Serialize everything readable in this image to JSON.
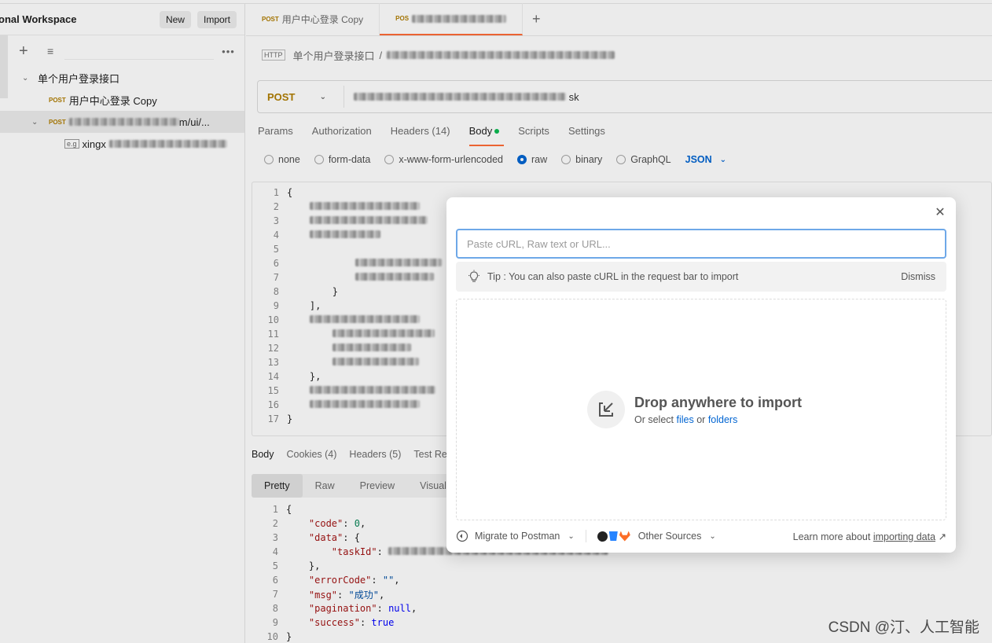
{
  "sidebar": {
    "workspace_title": "onal Workspace",
    "new_label": "New",
    "import_label": "Import",
    "tree": [
      {
        "label": "单个用户登录接口"
      },
      {
        "method": "POST",
        "label": "用户中心登录 Copy"
      },
      {
        "method": "POST",
        "label_tail": "m/ui/..."
      },
      {
        "label_head": "xingx"
      }
    ]
  },
  "tabs": [
    {
      "method": "POST",
      "label": "用户中心登录 Copy"
    },
    {
      "method": "POS"
    }
  ],
  "breadcrumb": {
    "parent": "单个用户登录接口",
    "sep": "/"
  },
  "request": {
    "method": "POST",
    "url_tail": "sk",
    "tabs": [
      "Params",
      "Authorization",
      "Headers (14)",
      "Body",
      "Scripts",
      "Settings"
    ],
    "body_types": [
      "none",
      "form-data",
      "x-www-form-urlencoded",
      "raw",
      "binary",
      "GraphQL"
    ],
    "selected_body_type": "raw",
    "format": "JSON"
  },
  "editor_lines": [
    "1",
    "2",
    "3",
    "4",
    "5",
    "6",
    "7",
    "8",
    "9",
    "10",
    "11",
    "12",
    "13",
    "14",
    "15",
    "16",
    "17"
  ],
  "response": {
    "tabs": [
      "Body",
      "Cookies (4)",
      "Headers (5)",
      "Test Re"
    ],
    "formats": [
      "Pretty",
      "Raw",
      "Preview",
      "Visual"
    ],
    "lines": [
      "1",
      "2",
      "3",
      "4",
      "5",
      "6",
      "7",
      "8",
      "9",
      "10"
    ]
  },
  "import_modal": {
    "paste_placeholder": "Paste cURL, Raw text or URL...",
    "tip": "Tip : You can also paste cURL in the request bar to import",
    "dismiss": "Dismiss",
    "drop_title": "Drop anywhere to import",
    "drop_sub_prefix": "Or select",
    "files": "files",
    "or": "or",
    "folders": "folders",
    "migrate": "Migrate to Postman",
    "other_sources": "Other Sources",
    "learn_prefix": "Learn more about",
    "learn_link": "importing data",
    "learn_arrow": "↗"
  },
  "watermark": "CSDN @汀、人工智能",
  "colors": {
    "accent": "#ff6c37",
    "link": "#0265d2",
    "post": "#b07d00",
    "focus": "#6ea8e8"
  }
}
